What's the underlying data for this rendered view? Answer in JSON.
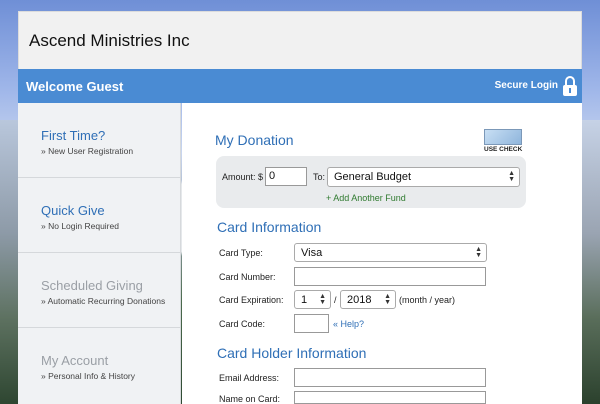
{
  "header": {
    "site_title": "Ascend Ministries Inc"
  },
  "bluebar": {
    "welcome": "Welcome Guest",
    "secure_login": "Secure Login"
  },
  "sidebar": {
    "items": [
      {
        "title": "First Time?",
        "subtitle": "» New User Registration",
        "enabled": true
      },
      {
        "title": "Quick Give",
        "subtitle": "» No Login Required",
        "enabled": true
      },
      {
        "title": "Scheduled Giving",
        "subtitle": "» Automatic Recurring Donations",
        "enabled": false
      },
      {
        "title": "My Account",
        "subtitle": "» Personal Info & History",
        "enabled": false
      }
    ]
  },
  "donation": {
    "heading": "My Donation",
    "use_check_label": "USE CHECK",
    "amount_label": "Amount: $",
    "amount_value": "0",
    "to_label": "To:",
    "fund_selected": "General Budget",
    "add_fund": "+ Add Another Fund"
  },
  "card": {
    "heading": "Card Information",
    "type_label": "Card Type:",
    "type_value": "Visa",
    "number_label": "Card Number:",
    "number_value": "",
    "exp_label": "Card Expiration:",
    "exp_month": "1",
    "exp_sep": "/",
    "exp_year": "2018",
    "exp_hint": "(month / year)",
    "code_label": "Card Code:",
    "code_value": "",
    "help": "« Help?"
  },
  "holder": {
    "heading": "Card Holder Information",
    "email_label": "Email Address:",
    "email_value": "",
    "name_label": "Name on Card:",
    "name_value": ""
  }
}
